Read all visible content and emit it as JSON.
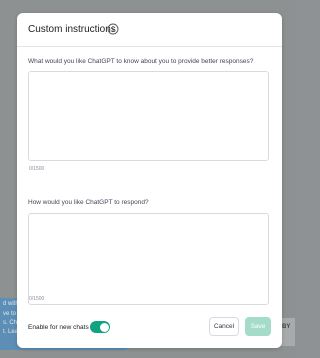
{
  "modal": {
    "title": "Custom instructions",
    "info_icon": "info-circle-icon",
    "question_about_you": "What would you like ChatGPT to know about you to provide better responses?",
    "about_you_value": "",
    "about_you_counter": "0/1500",
    "question_respond": "How would you like ChatGPT to respond?",
    "respond_value": "",
    "respond_counter": "0/1500",
    "enable_label": "Enable for new chats",
    "enable_on": true,
    "cancel_label": "Cancel",
    "save_label": "Save"
  },
  "background": {
    "left_panel_lines": [
      "d with",
      "ve to ",
      "s. Che",
      "t. Lea"
    ],
    "right_panel_text": "BY"
  },
  "colors": {
    "accent": "#10a37f",
    "save_disabled": "#a4dcc9",
    "overlay": "#8d9192",
    "tooltip_blue": "#5d8fb6"
  }
}
